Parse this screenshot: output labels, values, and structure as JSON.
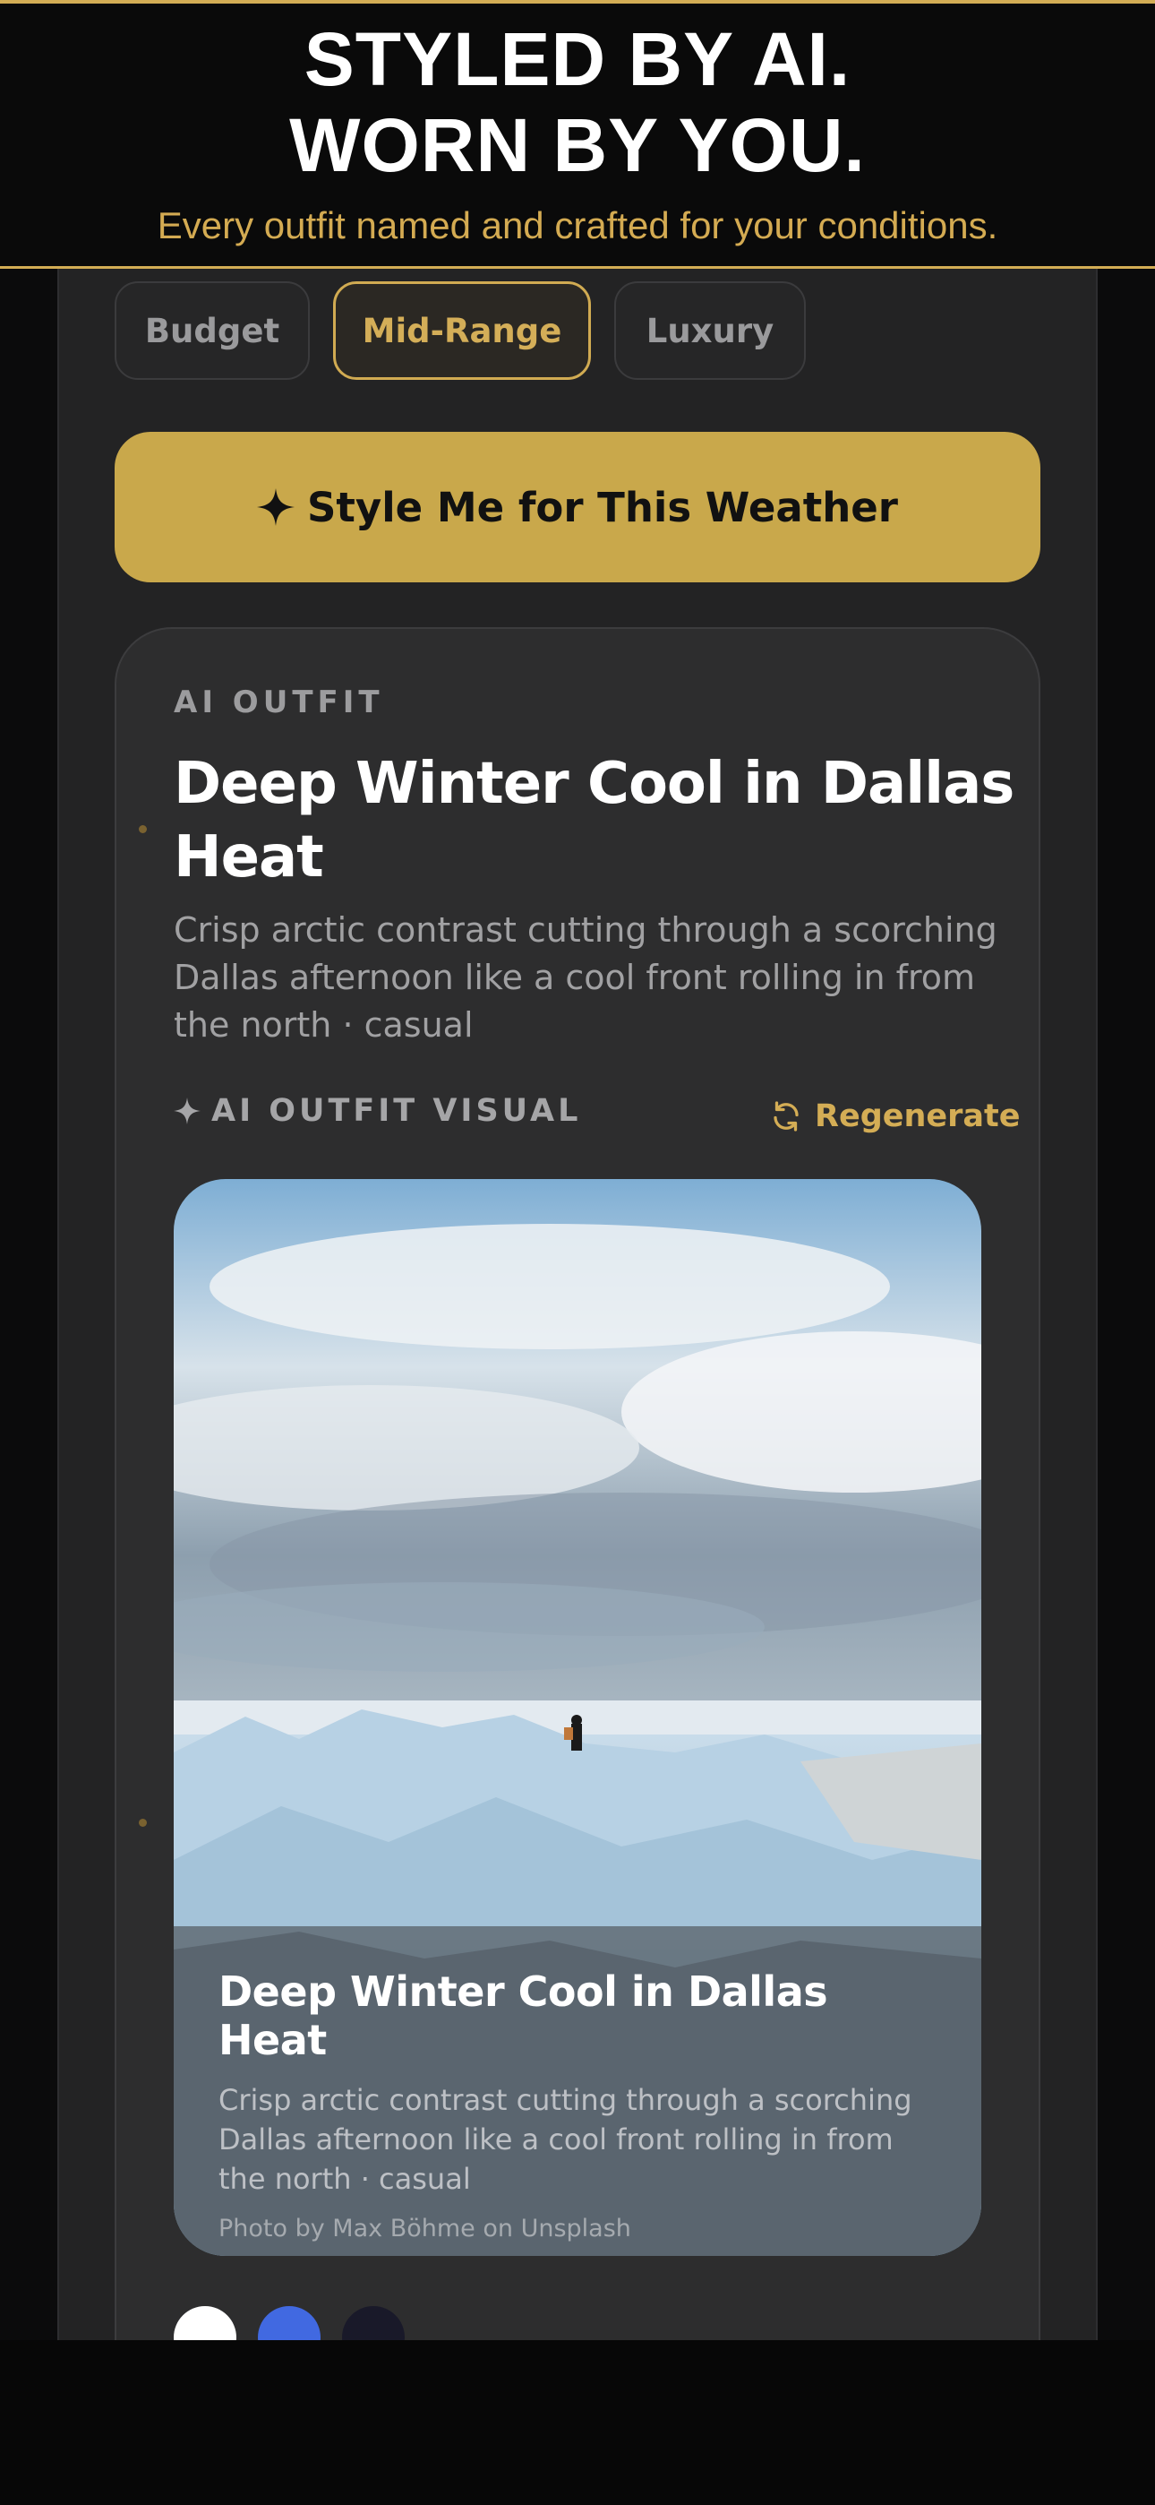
{
  "banner": {
    "title_line1": "STYLED BY AI.",
    "title_line2": "WORN BY YOU.",
    "subtitle": "Every outfit named and crafted for your conditions."
  },
  "budget": {
    "options": [
      "Budget",
      "Mid-Range",
      "Luxury"
    ],
    "selected": "Mid-Range"
  },
  "cta": {
    "icon": "sparkle-icon",
    "label": "Style Me for This Weather"
  },
  "card": {
    "eyebrow": "AI OUTFIT",
    "title": "Deep Winter Cool in Dallas Heat",
    "description": "Crisp arctic contrast cutting through a scorching Dallas afternoon like a cool front rolling in from the north · casual",
    "visual_label": "AI OUTFIT VISUAL",
    "regenerate_label": "Regenerate",
    "image": {
      "caption_title": "Deep Winter Cool in Dallas Heat",
      "caption_desc": "Crisp arctic contrast cutting through a scorching Dallas afternoon like a cool front rolling in from the north · casual",
      "credit": "Photo by Max Böhme on Unsplash"
    },
    "palette": [
      "#ffffff",
      "#4169e1",
      "#191929"
    ]
  },
  "colors": {
    "accent": "#c9a84b",
    "background": "#0b0b0c",
    "panel": "#232324",
    "card": "#2d2d2e"
  }
}
